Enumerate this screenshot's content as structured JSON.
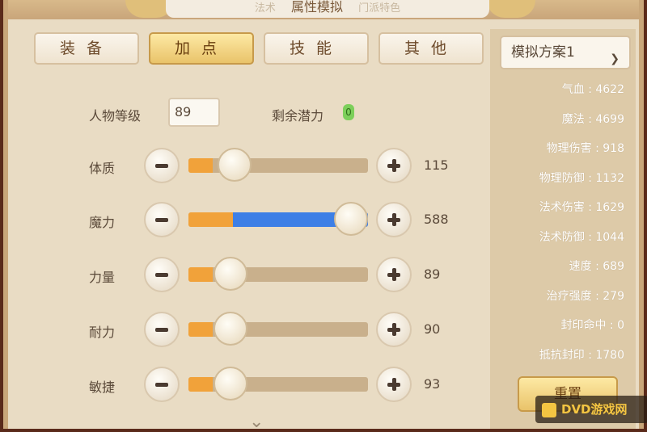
{
  "window": {
    "title": "属性模拟",
    "ghost_tabs": [
      "法术",
      "门派特色"
    ]
  },
  "tabs": [
    {
      "label": "装备",
      "active": false
    },
    {
      "label": "加点",
      "active": true
    },
    {
      "label": "技能",
      "active": false
    },
    {
      "label": "其他",
      "active": false
    }
  ],
  "level": {
    "label": "人物等级",
    "value": "89"
  },
  "potential": {
    "label": "剩余潜力",
    "value": "0"
  },
  "stats": [
    {
      "label": "体质",
      "value": "115",
      "level": 0.2
    },
    {
      "label": "魔力",
      "value": "588",
      "level": 1.0
    },
    {
      "label": "力量",
      "value": "89",
      "level": 0.17
    },
    {
      "label": "耐力",
      "value": "90",
      "level": 0.17
    },
    {
      "label": "敏捷",
      "value": "93",
      "level": 0.17
    }
  ],
  "scheme": {
    "selected": "模拟方案1"
  },
  "attributes": [
    {
      "text": "气血 : 4622"
    },
    {
      "text": "魔法 : 4699"
    },
    {
      "text": "物理伤害 : 918"
    },
    {
      "text": "物理防御 : 1132"
    },
    {
      "text": "法术伤害 : 1629"
    },
    {
      "text": "法术防御 : 1044"
    },
    {
      "text": "速度 : 689"
    },
    {
      "text": "治疗强度 : 279"
    },
    {
      "text": "封印命中 : 0"
    },
    {
      "text": "抵抗封印 : 1780"
    }
  ],
  "reset_label": "重置",
  "watermark": "DVD游戏网",
  "colors": {
    "accent": "#e9c36a",
    "fill": "#f1a23a",
    "magic": "#3d7fe6"
  },
  "icons": {
    "minus": "minus-icon",
    "plus": "plus-icon",
    "chevron": "chevron-down-icon"
  }
}
